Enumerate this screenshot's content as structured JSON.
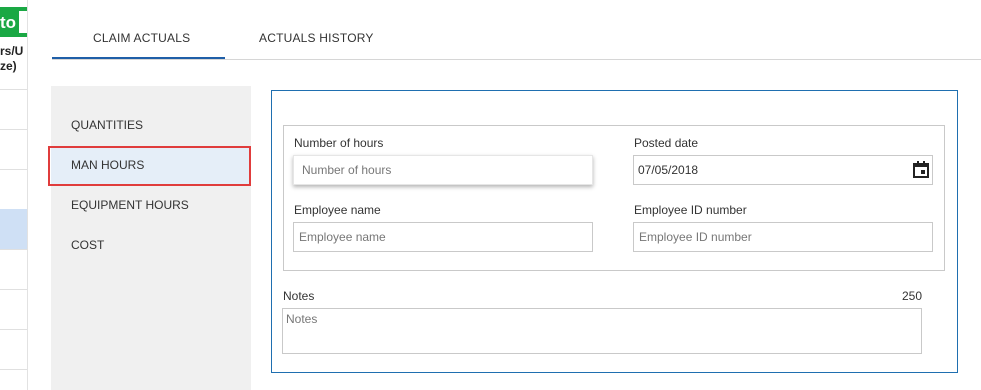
{
  "background": {
    "button_text": "to",
    "header_line1": "rs/U",
    "header_line2": "ze)"
  },
  "tabs": [
    {
      "label": "CLAIM ACTUALS",
      "active": true
    },
    {
      "label": "ACTUALS HISTORY",
      "active": false
    }
  ],
  "sidebar": {
    "items": [
      {
        "label": "QUANTITIES"
      },
      {
        "label": "MAN HOURS",
        "active": true
      },
      {
        "label": "EQUIPMENT HOURS"
      },
      {
        "label": "COST"
      }
    ]
  },
  "form": {
    "hours": {
      "label": "Number of hours",
      "placeholder": "Number of hours"
    },
    "posted_date": {
      "label": "Posted date",
      "value": "07/05/2018"
    },
    "employee_name": {
      "label": "Employee name",
      "placeholder": "Employee name"
    },
    "employee_id": {
      "label": "Employee ID number",
      "placeholder": "Employee ID number"
    },
    "notes": {
      "label": "Notes",
      "char_limit": "250",
      "placeholder": "Notes"
    }
  },
  "icons": {
    "calendar": "calendar-icon"
  },
  "colors": {
    "accent": "#1f5fa8",
    "highlight": "#e03c3c",
    "green": "#1aa844"
  }
}
